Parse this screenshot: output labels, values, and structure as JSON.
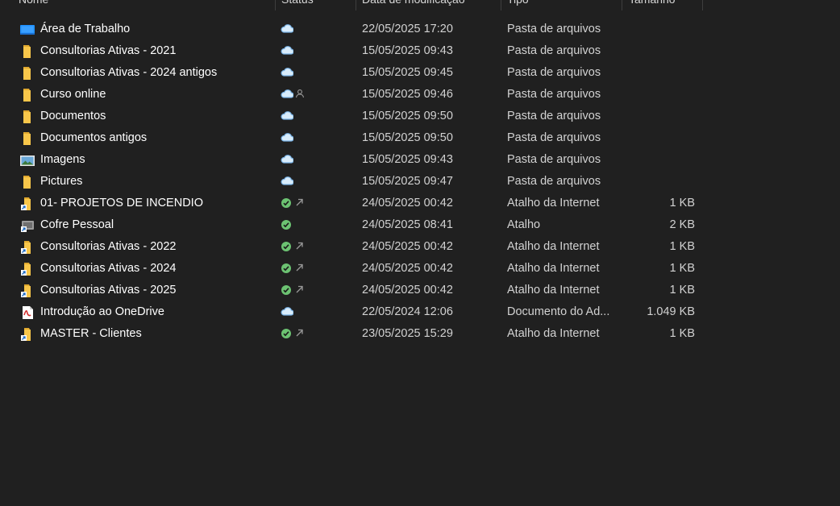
{
  "columns": {
    "name": "Nome",
    "status": "Status",
    "date": "Data de modificação",
    "type": "Tipo",
    "size": "Tamanho"
  },
  "files": [
    {
      "name": "Área de Trabalho",
      "icon": "desktop-folder-icon",
      "status": "cloud",
      "extra": "",
      "date": "22/05/2025 17:20",
      "type": "Pasta de arquivos",
      "size": ""
    },
    {
      "name": "Consultorias Ativas - 2021",
      "icon": "folder-icon",
      "status": "cloud",
      "extra": "",
      "date": "15/05/2025 09:43",
      "type": "Pasta de arquivos",
      "size": ""
    },
    {
      "name": "Consultorias Ativas - 2024 antigos",
      "icon": "folder-icon",
      "status": "cloud",
      "extra": "",
      "date": "15/05/2025 09:45",
      "type": "Pasta de arquivos",
      "size": ""
    },
    {
      "name": "Curso online",
      "icon": "folder-icon",
      "status": "cloud",
      "extra": "shared",
      "date": "15/05/2025 09:46",
      "type": "Pasta de arquivos",
      "size": ""
    },
    {
      "name": "Documentos",
      "icon": "folder-icon",
      "status": "cloud",
      "extra": "",
      "date": "15/05/2025 09:50",
      "type": "Pasta de arquivos",
      "size": ""
    },
    {
      "name": "Documentos antigos",
      "icon": "folder-icon",
      "status": "cloud",
      "extra": "",
      "date": "15/05/2025 09:50",
      "type": "Pasta de arquivos",
      "size": ""
    },
    {
      "name": "Imagens",
      "icon": "pictures-folder-icon",
      "status": "cloud",
      "extra": "",
      "date": "15/05/2025 09:43",
      "type": "Pasta de arquivos",
      "size": ""
    },
    {
      "name": "Pictures",
      "icon": "folder-icon",
      "status": "cloud",
      "extra": "",
      "date": "15/05/2025 09:47",
      "type": "Pasta de arquivos",
      "size": ""
    },
    {
      "name": "01- PROJETOS DE INCENDIO",
      "icon": "internet-shortcut-icon",
      "status": "synced",
      "extra": "shortcut",
      "date": "24/05/2025 00:42",
      "type": "Atalho da Internet",
      "size": "1 KB"
    },
    {
      "name": "Cofre Pessoal",
      "icon": "vault-shortcut-icon",
      "status": "synced",
      "extra": "",
      "date": "24/05/2025 08:41",
      "type": "Atalho",
      "size": "2 KB"
    },
    {
      "name": "Consultorias Ativas - 2022",
      "icon": "internet-shortcut-icon",
      "status": "synced",
      "extra": "shortcut",
      "date": "24/05/2025 00:42",
      "type": "Atalho da Internet",
      "size": "1 KB"
    },
    {
      "name": "Consultorias Ativas - 2024",
      "icon": "internet-shortcut-icon",
      "status": "synced",
      "extra": "shortcut",
      "date": "24/05/2025 00:42",
      "type": "Atalho da Internet",
      "size": "1 KB"
    },
    {
      "name": "Consultorias Ativas - 2025",
      "icon": "internet-shortcut-icon",
      "status": "synced",
      "extra": "shortcut",
      "date": "24/05/2025 00:42",
      "type": "Atalho da Internet",
      "size": "1 KB"
    },
    {
      "name": "Introdução ao OneDrive",
      "icon": "pdf-icon",
      "status": "cloud",
      "extra": "",
      "date": "22/05/2024 12:06",
      "type": "Documento do Ad...",
      "size": "1.049 KB"
    },
    {
      "name": "MASTER - Clientes",
      "icon": "internet-shortcut-icon",
      "status": "synced",
      "extra": "shortcut",
      "date": "23/05/2025 15:29",
      "type": "Atalho da Internet",
      "size": "1 KB"
    }
  ],
  "colors": {
    "background": "#202020",
    "folder": "#f8c64a",
    "cloud": "#7ab4e8",
    "synced": "#6cc272"
  }
}
